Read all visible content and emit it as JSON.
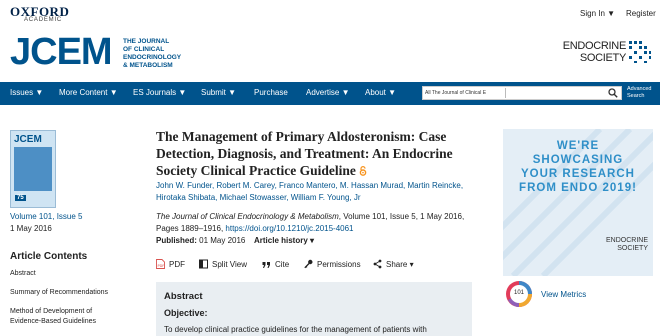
{
  "header": {
    "publisher": "OXFORD",
    "publisher_sub": "ACADEMIC",
    "sign_in": "Sign In ▼",
    "register": "Register",
    "journal_abbrev": "JCEM",
    "journal_name_lines": [
      "THE JOURNAL",
      "OF CLINICAL",
      "ENDOCRINOLOGY",
      "& METABOLISM"
    ],
    "society_lines": [
      "ENDOCRINE",
      "SOCIETY"
    ]
  },
  "nav": {
    "items": [
      "Issues ▼",
      "More Content ▼",
      "ES Journals ▼",
      "Submit ▼",
      "Purchase",
      "Advertise ▼",
      "About ▼"
    ],
    "search_scope": "All The Journal of Clinical E",
    "search_placeholder": "",
    "advanced_search_lines": [
      "Advanced",
      "Search"
    ]
  },
  "issue": {
    "cover_title": "JCEM",
    "cover_number": "75",
    "volume": "Volume 101, Issue 5",
    "date": "1 May 2016"
  },
  "contents": {
    "heading": "Article Contents",
    "items": [
      "Abstract",
      "Summary of Recommendations",
      "Method of Development of",
      "Evidence-Based Guidelines"
    ]
  },
  "article": {
    "title": "The Management of Primary Aldosteronism: Case Detection, Diagnosis, and Treatment: An Endocrine Society Clinical Practice Guideline",
    "authors_line1": "John W. Funder, Robert M. Carey, Franco Mantero, M. Hassan Murad, Martin Reincke,",
    "authors_line2": "Hirotaka Shibata, Michael Stowasser, William F. Young, Jr",
    "journal": "The Journal of Clinical Endocrinology & Metabolism",
    "citation_rest": ", Volume 101, Issue 5, 1 May 2016,",
    "pages": "Pages 1889–1916, ",
    "doi": "https://doi.org/10.1210/jc.2015-4061",
    "published_label": "Published:",
    "published_date": " 01 May 2016",
    "history": "Article history ▾"
  },
  "tools": {
    "pdf": "PDF",
    "split_view": "Split View",
    "cite": "Cite",
    "permissions": "Permissions",
    "share": "Share ▾"
  },
  "abstract": {
    "heading": "Abstract",
    "objective_label": "Objective:",
    "text": "To develop clinical practice guidelines for the management of patients with"
  },
  "ad": {
    "lines": [
      "WE'RE",
      "SHOWCASING",
      "YOUR RESEARCH",
      "FROM ENDO 2019!"
    ],
    "logo_lines": [
      "ENDOCRINE",
      "SOCIETY"
    ]
  },
  "metrics": {
    "altmetric_score": "101",
    "view_metrics": "View Metrics"
  },
  "colors": {
    "brand_blue": "#00538c",
    "ad_blue": "#2f8fc8",
    "oa_orange": "#f7931d"
  }
}
